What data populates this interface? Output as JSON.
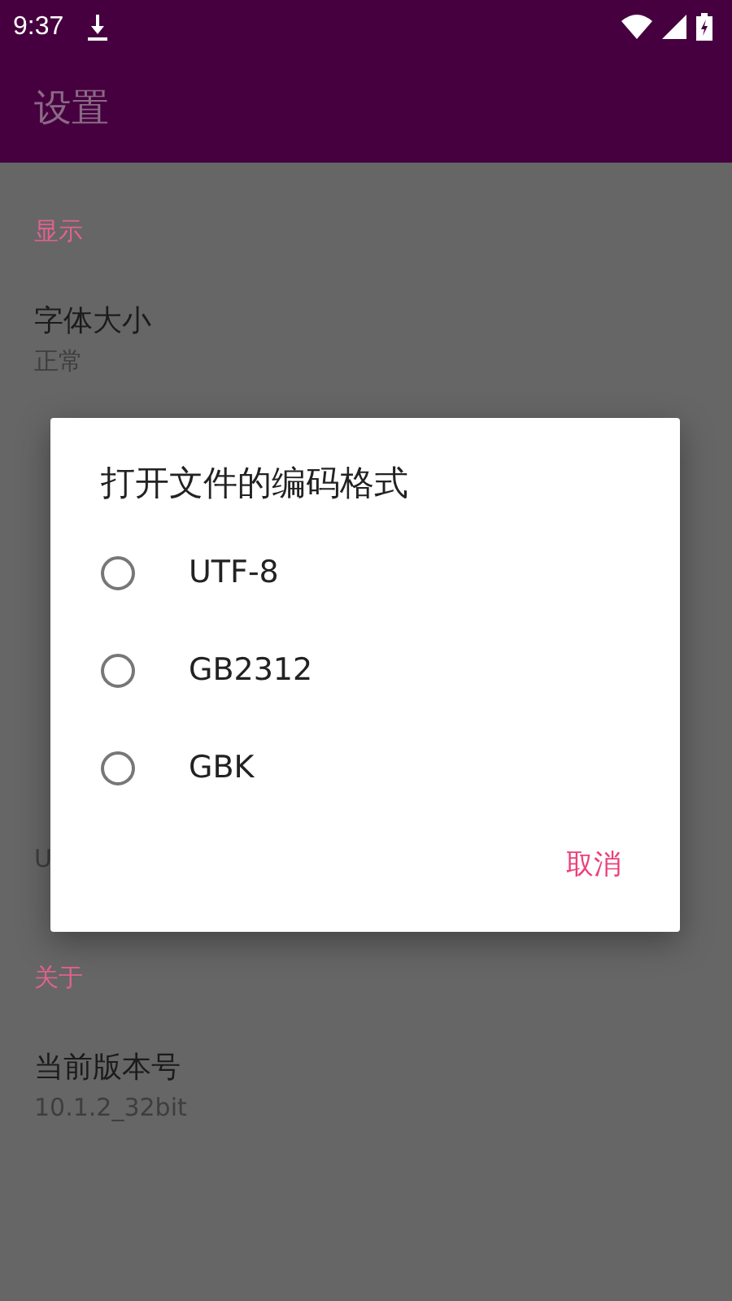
{
  "status_bar": {
    "time": "9:37"
  },
  "toolbar": {
    "title": "设置"
  },
  "settings": [
    {
      "kind": "header",
      "text": "显示"
    },
    {
      "kind": "item",
      "title": "字体大小",
      "summary": "正常"
    },
    {
      "kind": "header"
    },
    {
      "kind": "item"
    },
    {
      "kind": "header"
    },
    {
      "kind": "item",
      "summary": "U"
    },
    {
      "kind": "header",
      "text": "关于"
    },
    {
      "kind": "item",
      "title": "当前版本号",
      "summary": "10.1.2_32bit"
    }
  ],
  "dialog": {
    "title": "打开文件的编码格式",
    "options": [
      {
        "label": "UTF-8",
        "selected": false
      },
      {
        "label": "GB2312",
        "selected": false
      },
      {
        "label": "GBK",
        "selected": false
      }
    ],
    "buttons": [
      "取消"
    ]
  }
}
